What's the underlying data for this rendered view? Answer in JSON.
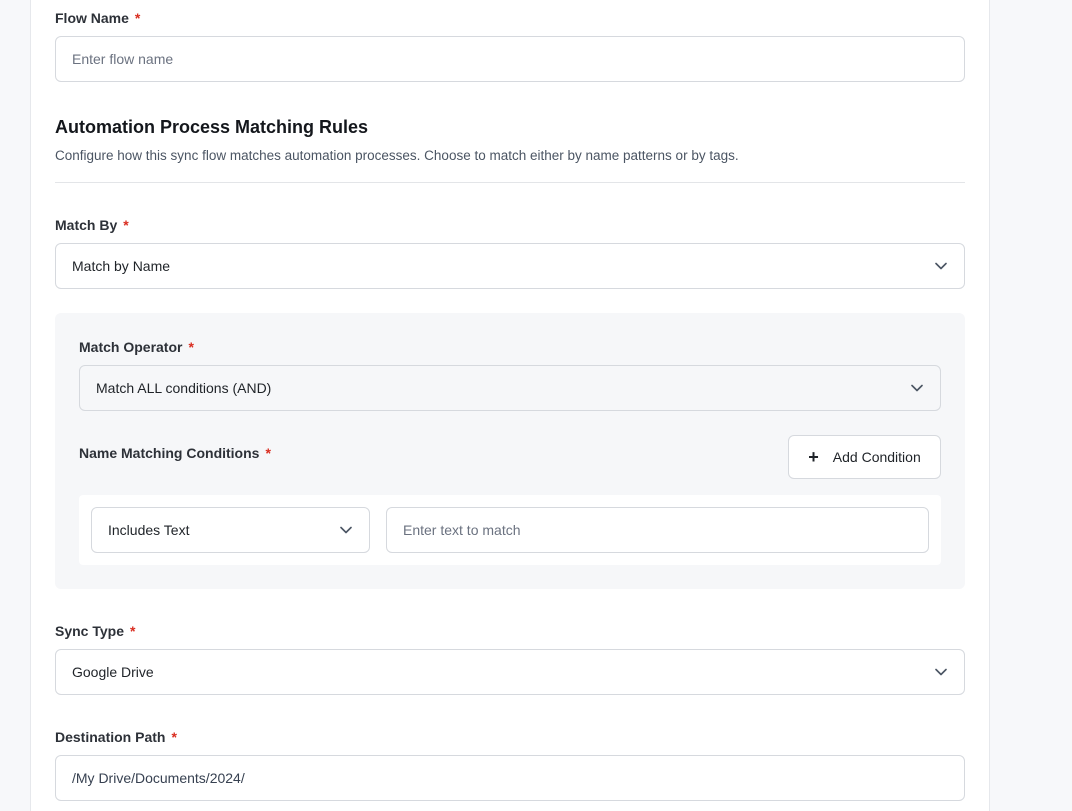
{
  "flow_name": {
    "label": "Flow Name",
    "required_mark": "*",
    "placeholder": "Enter flow name"
  },
  "matching_rules": {
    "title": "Automation Process Matching Rules",
    "description": "Configure how this sync flow matches automation processes. Choose to match either by name patterns or by tags."
  },
  "match_by": {
    "label": "Match By",
    "required_mark": "*",
    "value": "Match by Name"
  },
  "match_operator": {
    "label": "Match Operator",
    "required_mark": "*",
    "value": "Match ALL conditions (AND)"
  },
  "name_conditions": {
    "label": "Name Matching Conditions",
    "required_mark": "*",
    "add_button_label": "Add Condition",
    "add_button_icon": "plus-icon",
    "condition_type": "Includes Text",
    "text_placeholder": "Enter text to match"
  },
  "sync_type": {
    "label": "Sync Type",
    "required_mark": "*",
    "value": "Google Drive"
  },
  "destination_path": {
    "label": "Destination Path",
    "required_mark": "*",
    "value": "/My Drive/Documents/2024/"
  },
  "colors": {
    "required": "#d92d20",
    "border": "#d6d9de",
    "panel_bg": "#f6f7f9",
    "page_bg": "#f7f8fa"
  }
}
